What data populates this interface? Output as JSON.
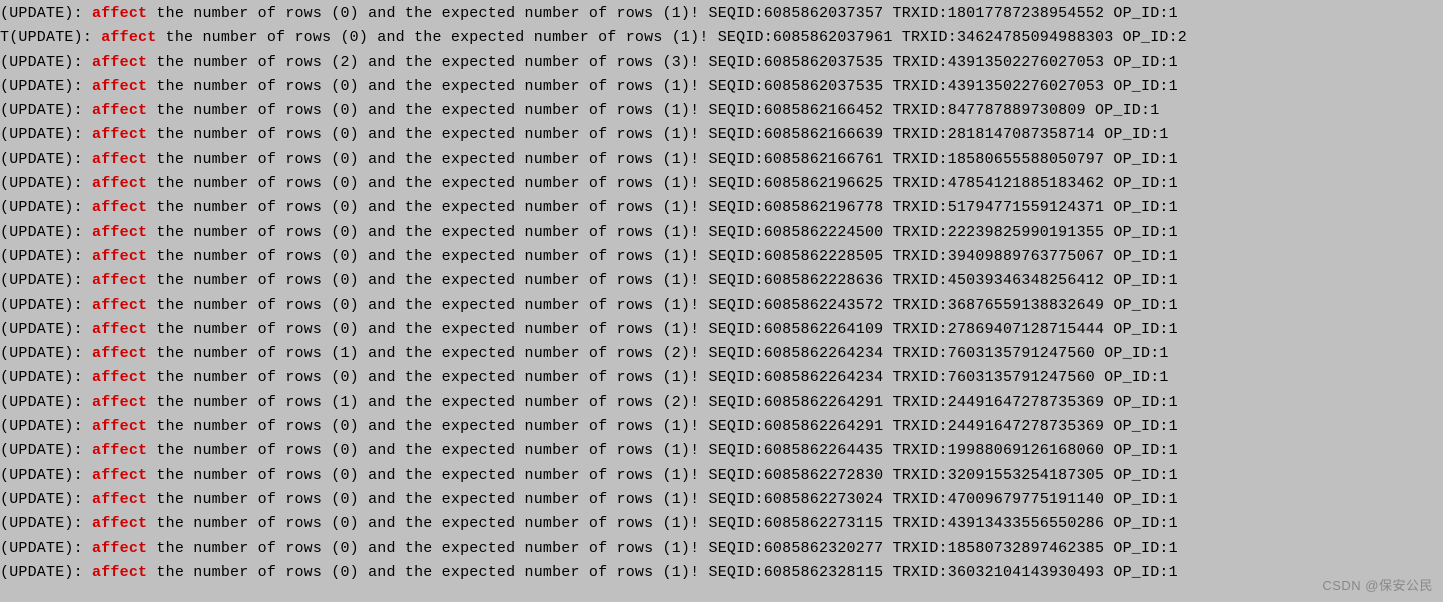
{
  "highlight_word": "affect",
  "watermark": "CSDN @保安公民",
  "lines": [
    {
      "prefix": "(UPDATE): ",
      "affected": "0",
      "expected": "1",
      "seqid": "6085862037357",
      "trxid": "18017787238954552",
      "opid": "1"
    },
    {
      "prefix": "T(UPDATE): ",
      "affected": "0",
      "expected": "1",
      "seqid": "6085862037961",
      "trxid": "34624785094988303",
      "opid": "2"
    },
    {
      "prefix": "(UPDATE): ",
      "affected": "2",
      "expected": "3",
      "seqid": "6085862037535",
      "trxid": "43913502276027053",
      "opid": "1"
    },
    {
      "prefix": "(UPDATE): ",
      "affected": "0",
      "expected": "1",
      "seqid": "6085862037535",
      "trxid": "43913502276027053",
      "opid": "1"
    },
    {
      "prefix": "(UPDATE): ",
      "affected": "0",
      "expected": "1",
      "seqid": "6085862166452",
      "trxid": "847787889730809",
      "opid": "1"
    },
    {
      "prefix": "(UPDATE): ",
      "affected": "0",
      "expected": "1",
      "seqid": "6085862166639",
      "trxid": "2818147087358714",
      "opid": "1"
    },
    {
      "prefix": "(UPDATE): ",
      "affected": "0",
      "expected": "1",
      "seqid": "6085862166761",
      "trxid": "18580655588050797",
      "opid": "1"
    },
    {
      "prefix": "(UPDATE): ",
      "affected": "0",
      "expected": "1",
      "seqid": "6085862196625",
      "trxid": "47854121885183462",
      "opid": "1"
    },
    {
      "prefix": "(UPDATE): ",
      "affected": "0",
      "expected": "1",
      "seqid": "6085862196778",
      "trxid": "51794771559124371",
      "opid": "1"
    },
    {
      "prefix": "(UPDATE): ",
      "affected": "0",
      "expected": "1",
      "seqid": "6085862224500",
      "trxid": "22239825990191355",
      "opid": "1"
    },
    {
      "prefix": "(UPDATE): ",
      "affected": "0",
      "expected": "1",
      "seqid": "6085862228505",
      "trxid": "39409889763775067",
      "opid": "1"
    },
    {
      "prefix": "(UPDATE): ",
      "affected": "0",
      "expected": "1",
      "seqid": "6085862228636",
      "trxid": "45039346348256412",
      "opid": "1"
    },
    {
      "prefix": "(UPDATE): ",
      "affected": "0",
      "expected": "1",
      "seqid": "6085862243572",
      "trxid": "36876559138832649",
      "opid": "1"
    },
    {
      "prefix": "(UPDATE): ",
      "affected": "0",
      "expected": "1",
      "seqid": "6085862264109",
      "trxid": "27869407128715444",
      "opid": "1"
    },
    {
      "prefix": "(UPDATE): ",
      "affected": "1",
      "expected": "2",
      "seqid": "6085862264234",
      "trxid": "7603135791247560",
      "opid": "1"
    },
    {
      "prefix": "(UPDATE): ",
      "affected": "0",
      "expected": "1",
      "seqid": "6085862264234",
      "trxid": "7603135791247560",
      "opid": "1"
    },
    {
      "prefix": "(UPDATE): ",
      "affected": "1",
      "expected": "2",
      "seqid": "6085862264291",
      "trxid": "24491647278735369",
      "opid": "1"
    },
    {
      "prefix": "(UPDATE): ",
      "affected": "0",
      "expected": "1",
      "seqid": "6085862264291",
      "trxid": "24491647278735369",
      "opid": "1"
    },
    {
      "prefix": "(UPDATE): ",
      "affected": "0",
      "expected": "1",
      "seqid": "6085862264435",
      "trxid": "19988069126168060",
      "opid": "1"
    },
    {
      "prefix": "(UPDATE): ",
      "affected": "0",
      "expected": "1",
      "seqid": "6085862272830",
      "trxid": "32091553254187305",
      "opid": "1"
    },
    {
      "prefix": "(UPDATE): ",
      "affected": "0",
      "expected": "1",
      "seqid": "6085862273024",
      "trxid": "47009679775191140",
      "opid": "1"
    },
    {
      "prefix": "(UPDATE): ",
      "affected": "0",
      "expected": "1",
      "seqid": "6085862273115",
      "trxid": "43913433556550286",
      "opid": "1"
    },
    {
      "prefix": "(UPDATE): ",
      "affected": "0",
      "expected": "1",
      "seqid": "6085862320277",
      "trxid": "18580732897462385",
      "opid": "1"
    },
    {
      "prefix": "(UPDATE): ",
      "affected": "0",
      "expected": "1",
      "seqid": "6085862328115",
      "trxid": "36032104143930493",
      "opid": "1"
    }
  ]
}
